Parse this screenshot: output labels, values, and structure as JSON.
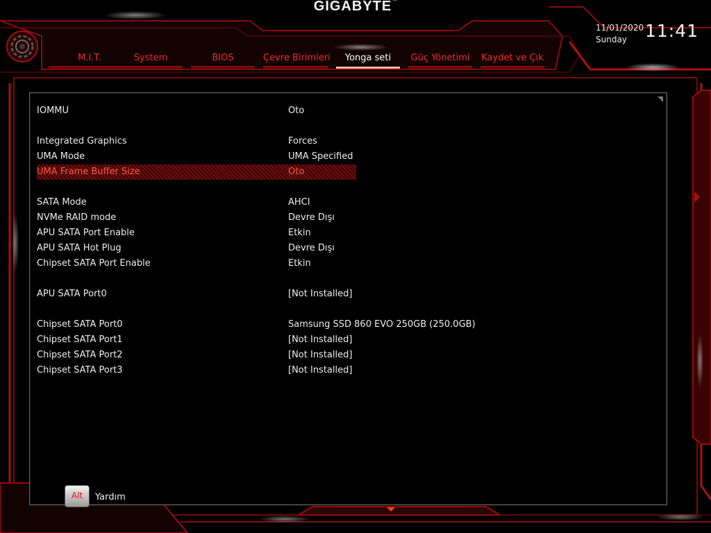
{
  "brand": "GIGABYTE",
  "date": "11/01/2020",
  "day": "Sunday",
  "time": "11:41",
  "tabs": [
    {
      "label": "M.I.T."
    },
    {
      "label": "System"
    },
    {
      "label": "BIOS"
    },
    {
      "label": "Çevre Birimleri"
    },
    {
      "label": "Yonga seti",
      "active": true
    },
    {
      "label": "Güç Yönetimi"
    },
    {
      "label": "Kaydet ve Çık"
    }
  ],
  "settings": [
    {
      "label": "IOMMU",
      "value": "Oto"
    },
    {
      "label": "Integrated Graphics",
      "value": "Forces"
    },
    {
      "label": "UMA Mode",
      "value": "UMA Specified"
    },
    {
      "label": "UMA Frame Buffer Size",
      "value": "Oto",
      "selected": true
    },
    {
      "label": "SATA Mode",
      "value": "AHCI"
    },
    {
      "label": "NVMe RAID mode",
      "value": "Devre Dışı"
    },
    {
      "label": "APU SATA Port Enable",
      "value": "Etkin"
    },
    {
      "label": "APU SATA Hot Plug",
      "value": "Devre Dışı"
    },
    {
      "label": "Chipset SATA Port Enable",
      "value": "Etkin"
    },
    {
      "label": "APU SATA Port0",
      "value": "[Not Installed]"
    },
    {
      "label": "Chipset SATA Port0",
      "value": "Samsung SSD 860 EVO 250GB (250.0GB)"
    },
    {
      "label": "Chipset SATA Port1",
      "value": "[Not Installed]"
    },
    {
      "label": "Chipset SATA Port2",
      "value": "[Not Installed]"
    },
    {
      "label": "Chipset SATA Port3",
      "value": "[Not Installed]"
    }
  ],
  "help": {
    "key": "Alt",
    "label": "Yardım"
  },
  "colors": {
    "accent": "#e0201a",
    "highlight": "#ff5a3b",
    "frame": "#8a0b0b",
    "background": "#000000"
  },
  "icons": {
    "settings": "gear-icon",
    "scroll_right": "arrow-right-icon",
    "scroll_down": "arrow-down-icon"
  }
}
